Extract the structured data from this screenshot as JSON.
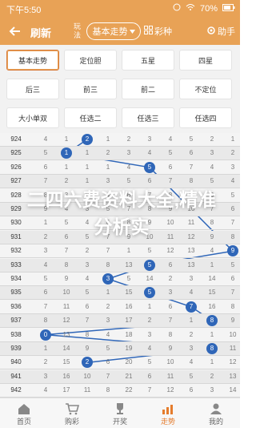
{
  "status_bar": {
    "time": "下午5:50",
    "battery": "70%"
  },
  "header": {
    "refresh_label": "刷新",
    "wanfa_label": "玩法",
    "trend_label": "基本走势",
    "colors_label": "彩种",
    "help_label": "助手"
  },
  "menu": {
    "items": [
      {
        "label": "基本走势",
        "active": true
      },
      {
        "label": "定位胆"
      },
      {
        "label": "五星"
      },
      {
        "label": "四星"
      },
      {
        "label": "后三"
      },
      {
        "label": "前三"
      },
      {
        "label": "前二"
      },
      {
        "label": "不定位"
      },
      {
        "label": "大小单双"
      },
      {
        "label": "任选二"
      },
      {
        "label": "任选三"
      },
      {
        "label": "任选四"
      }
    ]
  },
  "overlay_title": "二四六费资料大全,精准分析实",
  "rows": [
    {
      "issue": "924",
      "cells": [
        "4",
        "1",
        "2",
        "1",
        "2",
        "3",
        "4",
        "5",
        "2",
        "1"
      ],
      "hit": 2
    },
    {
      "issue": "925",
      "cells": [
        "5",
        "1",
        "1",
        "2",
        "3",
        "4",
        "5",
        "6",
        "3",
        "2"
      ],
      "hit": 1
    },
    {
      "issue": "926",
      "cells": [
        "6",
        "1",
        "1",
        "1",
        "4",
        "5",
        "6",
        "7",
        "4",
        "3"
      ],
      "hit": 5
    },
    {
      "issue": "927",
      "cells": [
        "7",
        "2",
        "1",
        "3",
        "5",
        "6",
        "7",
        "8",
        "5",
        "4"
      ],
      "hit": -1
    },
    {
      "issue": "928",
      "cells": [
        "8",
        "3",
        "2",
        "4",
        "6",
        "7",
        "8",
        "9",
        "6",
        "5"
      ],
      "hit": -1
    },
    {
      "issue": "929",
      "cells": [
        "9",
        "4",
        "3",
        "5",
        "7",
        "8",
        "9",
        "10",
        "7",
        "6"
      ],
      "hit": -1
    },
    {
      "issue": "930",
      "cells": [
        "1",
        "5",
        "4",
        "6",
        "8",
        "9",
        "10",
        "11",
        "8",
        "7"
      ],
      "hit": -1
    },
    {
      "issue": "931",
      "cells": [
        "2",
        "6",
        "5",
        "7",
        "9",
        "10",
        "11",
        "12",
        "9",
        "8"
      ],
      "hit": -1
    },
    {
      "issue": "932",
      "cells": [
        "3",
        "7",
        "2",
        "7",
        "1",
        "5",
        "12",
        "13",
        "4",
        "9"
      ],
      "hit": 9
    },
    {
      "issue": "933",
      "cells": [
        "4",
        "8",
        "3",
        "8",
        "13",
        "5",
        "6",
        "13",
        "1",
        "5"
      ],
      "hit": 5
    },
    {
      "issue": "934",
      "cells": [
        "5",
        "9",
        "4",
        "3",
        "5",
        "14",
        "2",
        "3",
        "14",
        "6"
      ],
      "hit": 3
    },
    {
      "issue": "935",
      "cells": [
        "6",
        "10",
        "5",
        "1",
        "15",
        "5",
        "3",
        "4",
        "15",
        "7"
      ],
      "hit": 5
    },
    {
      "issue": "936",
      "cells": [
        "7",
        "11",
        "6",
        "2",
        "16",
        "1",
        "6",
        "7",
        "16",
        "8"
      ],
      "hit": 7
    },
    {
      "issue": "937",
      "cells": [
        "8",
        "12",
        "7",
        "3",
        "17",
        "2",
        "7",
        "1",
        "8",
        "9"
      ],
      "hit": 8
    },
    {
      "issue": "938",
      "cells": [
        "0",
        "13",
        "8",
        "4",
        "18",
        "3",
        "8",
        "2",
        "1",
        "10"
      ],
      "hit": 0
    },
    {
      "issue": "939",
      "cells": [
        "1",
        "14",
        "9",
        "5",
        "19",
        "4",
        "9",
        "3",
        "8",
        "11"
      ],
      "hit": 8
    },
    {
      "issue": "940",
      "cells": [
        "2",
        "15",
        "2",
        "6",
        "20",
        "5",
        "10",
        "4",
        "1",
        "12"
      ],
      "hit": 2
    },
    {
      "issue": "941",
      "cells": [
        "3",
        "16",
        "10",
        "7",
        "21",
        "6",
        "11",
        "5",
        "2",
        "13"
      ],
      "hit": -1
    },
    {
      "issue": "942",
      "cells": [
        "4",
        "17",
        "11",
        "8",
        "22",
        "7",
        "12",
        "6",
        "3",
        "14"
      ],
      "hit": -1
    }
  ],
  "tabs": [
    {
      "label": "首页",
      "icon": "home-icon"
    },
    {
      "label": "购彩",
      "icon": "cart-icon"
    },
    {
      "label": "开奖",
      "icon": "trophy-icon"
    },
    {
      "label": "走势",
      "icon": "chart-icon",
      "active": true
    },
    {
      "label": "我的",
      "icon": "user-icon"
    }
  ],
  "colors": {
    "accent": "#e8a256",
    "hit": "#2f66b8",
    "active_tab": "#e57c2d"
  }
}
